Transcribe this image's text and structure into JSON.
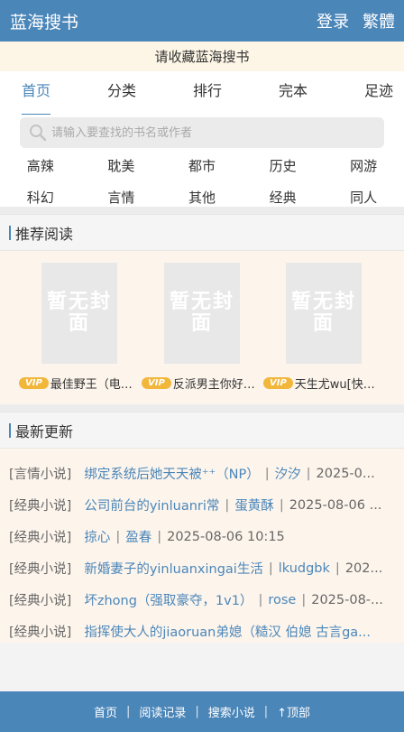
{
  "header": {
    "title": "蓝海搜书",
    "login": "登录",
    "traditional": "繁體"
  },
  "notice": "请收藏蓝海搜书",
  "nav": [
    "首页",
    "分类",
    "排行",
    "完本",
    "足迹"
  ],
  "search": {
    "placeholder": "请输入要查找的书名或作者"
  },
  "categories": [
    "高辣",
    "耽美",
    "都市",
    "历史",
    "网游",
    "科幻",
    "言情",
    "其他",
    "经典",
    "同人"
  ],
  "recommend": {
    "heading": "推荐阅读",
    "cover_text": "暂无封面",
    "vip": "VIP",
    "books": [
      "最佳野王（电…",
      "反派男主你好…",
      "天生尤wu[快…"
    ]
  },
  "latest": {
    "heading": "最新更新",
    "rows": [
      {
        "cat": "[言情小说]",
        "title": "绑定系统后她天天被⁺⁺（NP）",
        "author": "汐汐",
        "date": "2025-0..."
      },
      {
        "cat": "[经典小说]",
        "title": "公司前台的yinluanri常",
        "author": "蛋黄酥",
        "date": "2025-08-06 ..."
      },
      {
        "cat": "[经典小说]",
        "title": "掠心",
        "author": "盈春",
        "date": "2025-08-06 10:15"
      },
      {
        "cat": "[经典小说]",
        "title": "新婚妻子的yinluanxingai生活",
        "author": "lkudgbk",
        "date": "202..."
      },
      {
        "cat": "[经典小说]",
        "title": "坏zhong（强取豪夺，1v1）",
        "author": "rose",
        "date": "2025-08-..."
      },
      {
        "cat": "[经典小说]",
        "title": "指挥使大人的jiaoruan弟媳（糙汉 伯媳 古言ga...",
        "author": "",
        "date": ""
      }
    ]
  },
  "footer": {
    "home": "首页",
    "history": "阅读记录",
    "search": "搜索小说",
    "top": "↑顶部"
  }
}
